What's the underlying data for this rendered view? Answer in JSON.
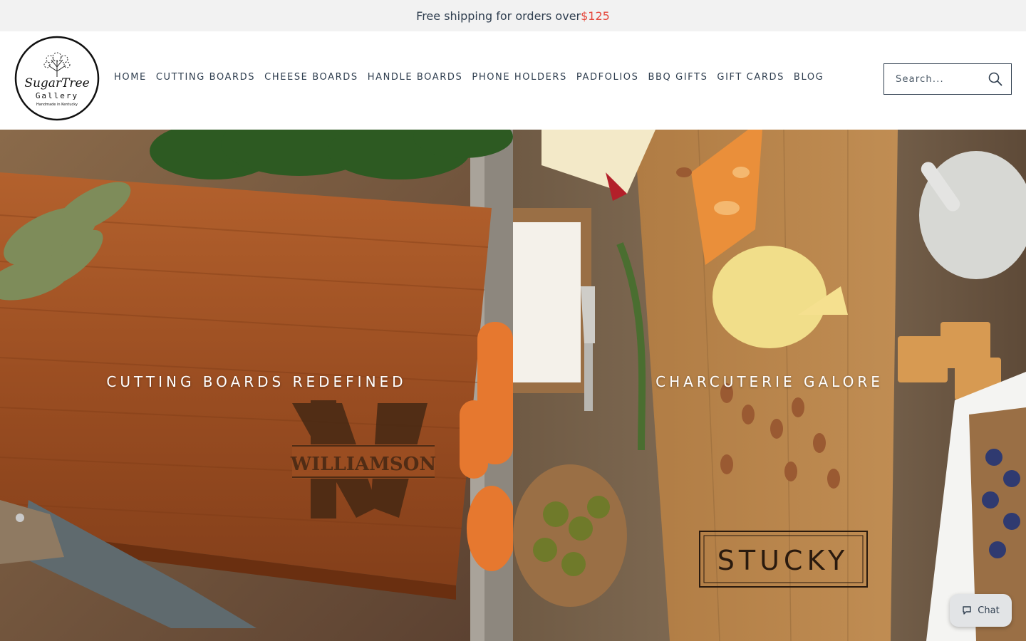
{
  "announcement": {
    "text_prefix": "Free shipping for orders over ",
    "price": "$125"
  },
  "logo": {
    "line1": "SugarTree",
    "line2": "Gallery",
    "tagline": "Handmade in Kentucky",
    "icon": "tree-icon"
  },
  "nav": {
    "items": [
      {
        "label": "HOME"
      },
      {
        "label": "CUTTING BOARDS"
      },
      {
        "label": "CHEESE BOARDS"
      },
      {
        "label": "HANDLE BOARDS"
      },
      {
        "label": "PHONE HOLDERS"
      },
      {
        "label": "PADFOLIOS"
      },
      {
        "label": "BBQ GIFTS"
      },
      {
        "label": "GIFT CARDS"
      },
      {
        "label": "BLOG"
      }
    ]
  },
  "search": {
    "placeholder": "Search...",
    "value": "",
    "icon": "search-icon"
  },
  "hero": {
    "left": {
      "title": "CUTTING BOARDS REDEFINED",
      "engraving": "WILLIAMSON",
      "monogram": "W"
    },
    "right": {
      "title": "CHARCUTERIE GALORE",
      "engraving": "STUCKY"
    }
  },
  "chat": {
    "label": "Chat",
    "icon": "chat-bubble-icon"
  },
  "colors": {
    "announcement_bg": "#f2f2f2",
    "price_accent": "#e5483c",
    "nav_text": "#2f3e4f",
    "board_wood": "#9b4e22"
  }
}
